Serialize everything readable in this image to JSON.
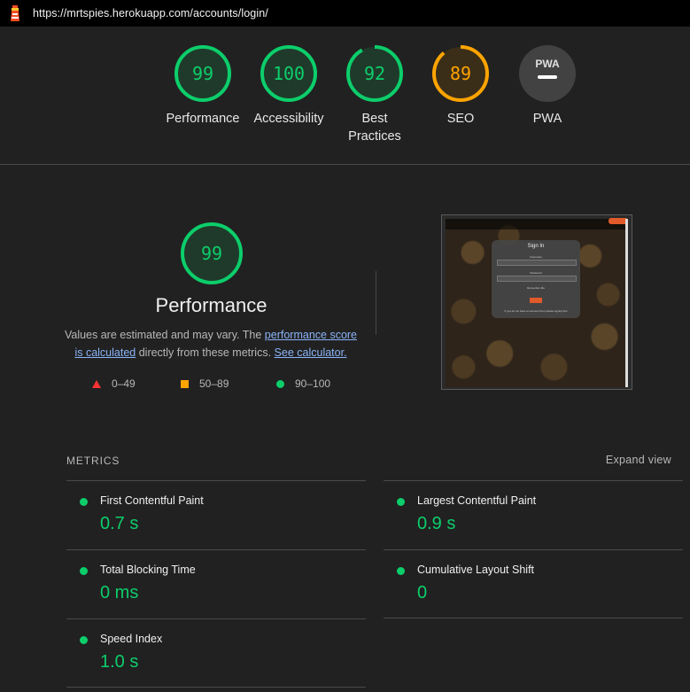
{
  "url": "https://mrtspies.herokuapp.com/accounts/login/",
  "colors": {
    "pass": "#0cce6b",
    "average": "#ffa400",
    "fail": "#ff3333",
    "na": "#5f6368"
  },
  "gauges": [
    {
      "score": "99",
      "label": "Performance",
      "status": "pass"
    },
    {
      "score": "100",
      "label": "Accessibility",
      "status": "pass"
    },
    {
      "score": "92",
      "label": "Best Practices",
      "status": "pass"
    },
    {
      "score": "89",
      "label": "SEO",
      "status": "average"
    },
    {
      "score": "",
      "label": "PWA",
      "status": "na"
    }
  ],
  "performance": {
    "score": "99",
    "title": "Performance",
    "desc_prefix": "Values are estimated and may vary. The",
    "link_score": "performance score is calculated",
    "desc_middle": "directly from these metrics.",
    "link_calc": "See calculator."
  },
  "legend": [
    "0–49",
    "50–89",
    "90–100"
  ],
  "thumbnail": {
    "card_title": "Sign In",
    "username_label": "Username",
    "password_label": "Password",
    "remember_label": "Remember Me",
    "button": "Sign In",
    "footer": "If you do not have an account then please signup first"
  },
  "metrics": {
    "heading": "METRICS",
    "expand_label": "Expand view",
    "items": [
      {
        "name": "First Contentful Paint",
        "value": "0.7 s"
      },
      {
        "name": "Largest Contentful Paint",
        "value": "0.9 s"
      },
      {
        "name": "Total Blocking Time",
        "value": "0 ms"
      },
      {
        "name": "Cumulative Layout Shift",
        "value": "0"
      },
      {
        "name": "Speed Index",
        "value": "1.0 s"
      }
    ]
  }
}
